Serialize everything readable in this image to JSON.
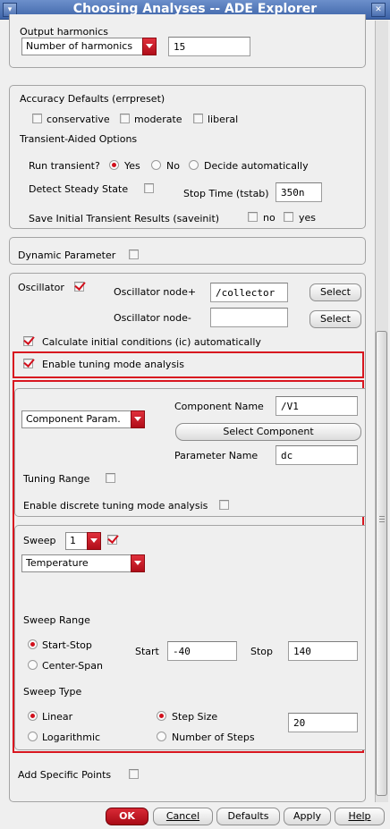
{
  "window": {
    "title": "Choosing Analyses -- ADE Explorer",
    "menu_icon": "window-menu-icon",
    "close_icon": "close-icon"
  },
  "harmonics": {
    "label": "Output harmonics",
    "mode": "Number of harmonics",
    "value": "15"
  },
  "accuracy": {
    "label": "Accuracy Defaults (errpreset)",
    "options": [
      "conservative",
      "moderate",
      "liberal"
    ]
  },
  "transient_aided": {
    "label": "Transient-Aided Options",
    "run_label": "Run transient?",
    "run_options": [
      "Yes",
      "No",
      "Decide automatically"
    ],
    "run_selected": "Yes",
    "steady_state_label": "Detect Steady State",
    "stop_time_label": "Stop Time (tstab)",
    "stop_time_value": "350n",
    "save_label": "Save Initial Transient Results (saveinit)",
    "save_options": [
      "no",
      "yes"
    ]
  },
  "dynamic": {
    "label": "Dynamic Parameter"
  },
  "oscillator": {
    "label": "Oscillator",
    "checked": true,
    "node_plus_label": "Oscillator node+",
    "node_plus_value": "/collector",
    "node_minus_label": "Oscillator node-",
    "node_minus_value": "",
    "select_label": "Select",
    "ic_label": "Calculate initial conditions (ic) automatically",
    "ic_checked": true
  },
  "tuning": {
    "enable_label": "Enable tuning mode analysis",
    "enable_checked": true,
    "kind": "Component Param.",
    "component_name_label": "Component Name",
    "component_name_value": "/V1",
    "select_component_label": "Select Component",
    "param_name_label": "Parameter Name",
    "param_name_value": "dc",
    "range_label": "Tuning Range",
    "discrete_label": "Enable discrete tuning mode analysis"
  },
  "sweep": {
    "label": "Sweep",
    "index": "1",
    "checked": true,
    "variable": "Temperature",
    "range_label": "Sweep Range",
    "range_options": [
      "Start-Stop",
      "Center-Span"
    ],
    "range_selected": "Start-Stop",
    "start_label": "Start",
    "start_value": "-40",
    "stop_label": "Stop",
    "stop_value": "140",
    "type_label": "Sweep Type",
    "type_options": [
      "Linear",
      "Logarithmic"
    ],
    "type_selected": "Linear",
    "step_options": [
      "Step Size",
      "Number of Steps"
    ],
    "step_selected": "Step Size",
    "step_value": "20"
  },
  "specific_points": {
    "label": "Add Specific Points"
  },
  "footer": {
    "ok": "OK",
    "cancel": "Cancel",
    "defaults": "Defaults",
    "apply": "Apply",
    "help": "Help"
  },
  "colors": {
    "accent_red": "#d10f1c",
    "titlebar_blue": "#4a6fb0",
    "highlight_box": "#d8161f"
  }
}
